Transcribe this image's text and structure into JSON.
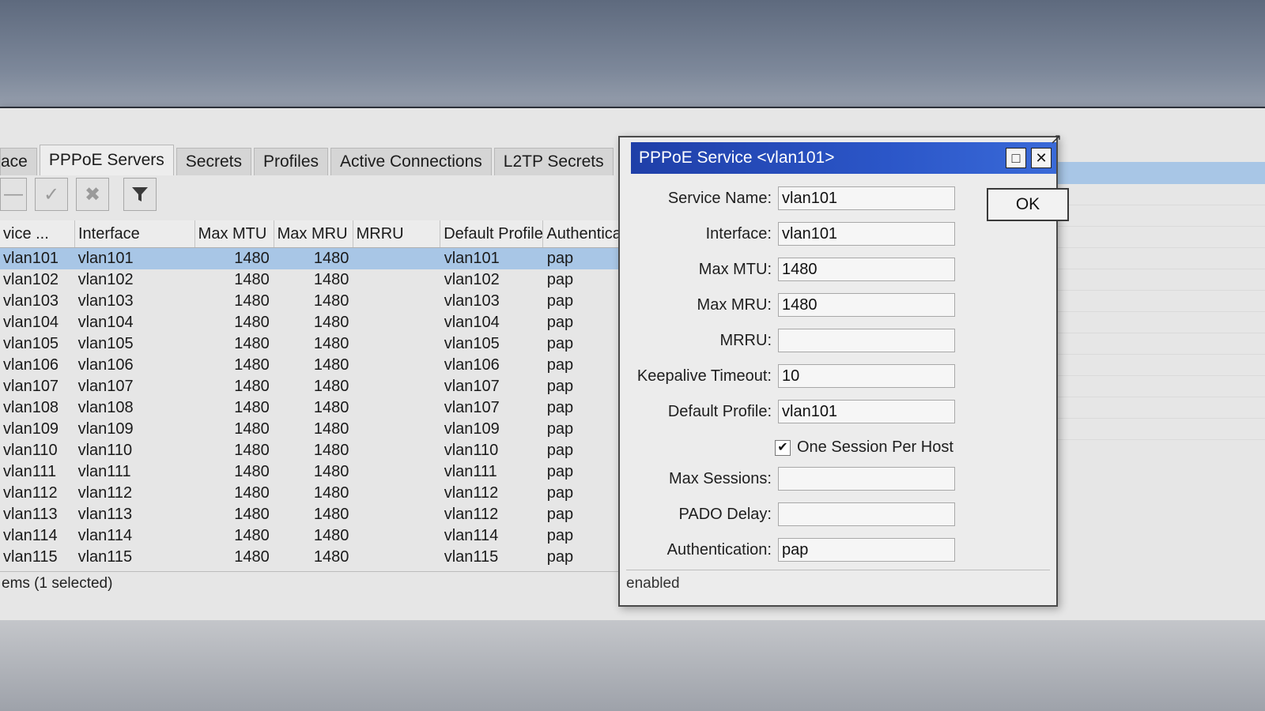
{
  "tabs": [
    {
      "label": "ace",
      "active": false
    },
    {
      "label": "PPPoE Servers",
      "active": true
    },
    {
      "label": "Secrets",
      "active": false
    },
    {
      "label": "Profiles",
      "active": false
    },
    {
      "label": "Active Connections",
      "active": false
    },
    {
      "label": "L2TP Secrets",
      "active": false
    }
  ],
  "toolbar": {
    "icons": [
      "minus-icon",
      "check-icon",
      "x-icon",
      "filter-icon"
    ]
  },
  "table": {
    "columns": [
      "vice ...",
      "Interface",
      "Max MTU",
      "Max MRU",
      "MRRU",
      "Default Profile",
      "Authenticat"
    ],
    "rows": [
      {
        "service": "vlan101",
        "interface": "vlan101",
        "mtu": "1480",
        "mru": "1480",
        "mrru": "",
        "profile": "vlan101",
        "auth": "pap"
      },
      {
        "service": "vlan102",
        "interface": "vlan102",
        "mtu": "1480",
        "mru": "1480",
        "mrru": "",
        "profile": "vlan102",
        "auth": "pap"
      },
      {
        "service": "vlan103",
        "interface": "vlan103",
        "mtu": "1480",
        "mru": "1480",
        "mrru": "",
        "profile": "vlan103",
        "auth": "pap"
      },
      {
        "service": "vlan104",
        "interface": "vlan104",
        "mtu": "1480",
        "mru": "1480",
        "mrru": "",
        "profile": "vlan104",
        "auth": "pap"
      },
      {
        "service": "vlan105",
        "interface": "vlan105",
        "mtu": "1480",
        "mru": "1480",
        "mrru": "",
        "profile": "vlan105",
        "auth": "pap"
      },
      {
        "service": "vlan106",
        "interface": "vlan106",
        "mtu": "1480",
        "mru": "1480",
        "mrru": "",
        "profile": "vlan106",
        "auth": "pap"
      },
      {
        "service": "vlan107",
        "interface": "vlan107",
        "mtu": "1480",
        "mru": "1480",
        "mrru": "",
        "profile": "vlan107",
        "auth": "pap"
      },
      {
        "service": "vlan108",
        "interface": "vlan108",
        "mtu": "1480",
        "mru": "1480",
        "mrru": "",
        "profile": "vlan107",
        "auth": "pap"
      },
      {
        "service": "vlan109",
        "interface": "vlan109",
        "mtu": "1480",
        "mru": "1480",
        "mrru": "",
        "profile": "vlan109",
        "auth": "pap"
      },
      {
        "service": "vlan110",
        "interface": "vlan110",
        "mtu": "1480",
        "mru": "1480",
        "mrru": "",
        "profile": "vlan110",
        "auth": "pap"
      },
      {
        "service": "vlan111",
        "interface": "vlan111",
        "mtu": "1480",
        "mru": "1480",
        "mrru": "",
        "profile": "vlan111",
        "auth": "pap"
      },
      {
        "service": "vlan112",
        "interface": "vlan112",
        "mtu": "1480",
        "mru": "1480",
        "mrru": "",
        "profile": "vlan112",
        "auth": "pap"
      },
      {
        "service": "vlan113",
        "interface": "vlan113",
        "mtu": "1480",
        "mru": "1480",
        "mrru": "",
        "profile": "vlan112",
        "auth": "pap"
      },
      {
        "service": "vlan114",
        "interface": "vlan114",
        "mtu": "1480",
        "mru": "1480",
        "mrru": "",
        "profile": "vlan114",
        "auth": "pap"
      },
      {
        "service": "vlan115",
        "interface": "vlan115",
        "mtu": "1480",
        "mru": "1480",
        "mrru": "",
        "profile": "vlan115",
        "auth": "pap"
      }
    ],
    "selected_index": 0
  },
  "status": {
    "items": "ems (1 selected)"
  },
  "dialog": {
    "title": "PPPoE Service <vlan101>",
    "ok_label": "OK",
    "fields": {
      "service_name": {
        "label": "Service Name:",
        "value": "vlan101"
      },
      "interface": {
        "label": "Interface:",
        "value": "vlan101"
      },
      "max_mtu": {
        "label": "Max MTU:",
        "value": "1480"
      },
      "max_mru": {
        "label": "Max MRU:",
        "value": "1480"
      },
      "mrru": {
        "label": "MRRU:",
        "value": ""
      },
      "keepalive": {
        "label": "Keepalive Timeout:",
        "value": "10"
      },
      "default_profile": {
        "label": "Default Profile:",
        "value": "vlan101"
      },
      "one_session": {
        "label": "One Session Per Host",
        "checked": true
      },
      "max_sessions": {
        "label": "Max Sessions:",
        "value": ""
      },
      "pado_delay": {
        "label": "PADO Delay:",
        "value": ""
      },
      "authentication": {
        "label": "Authentication:",
        "value": "pap"
      }
    },
    "status": "enabled"
  },
  "colors": {
    "title_bar": "#2b56c8",
    "selection": "#a8c6e6"
  }
}
